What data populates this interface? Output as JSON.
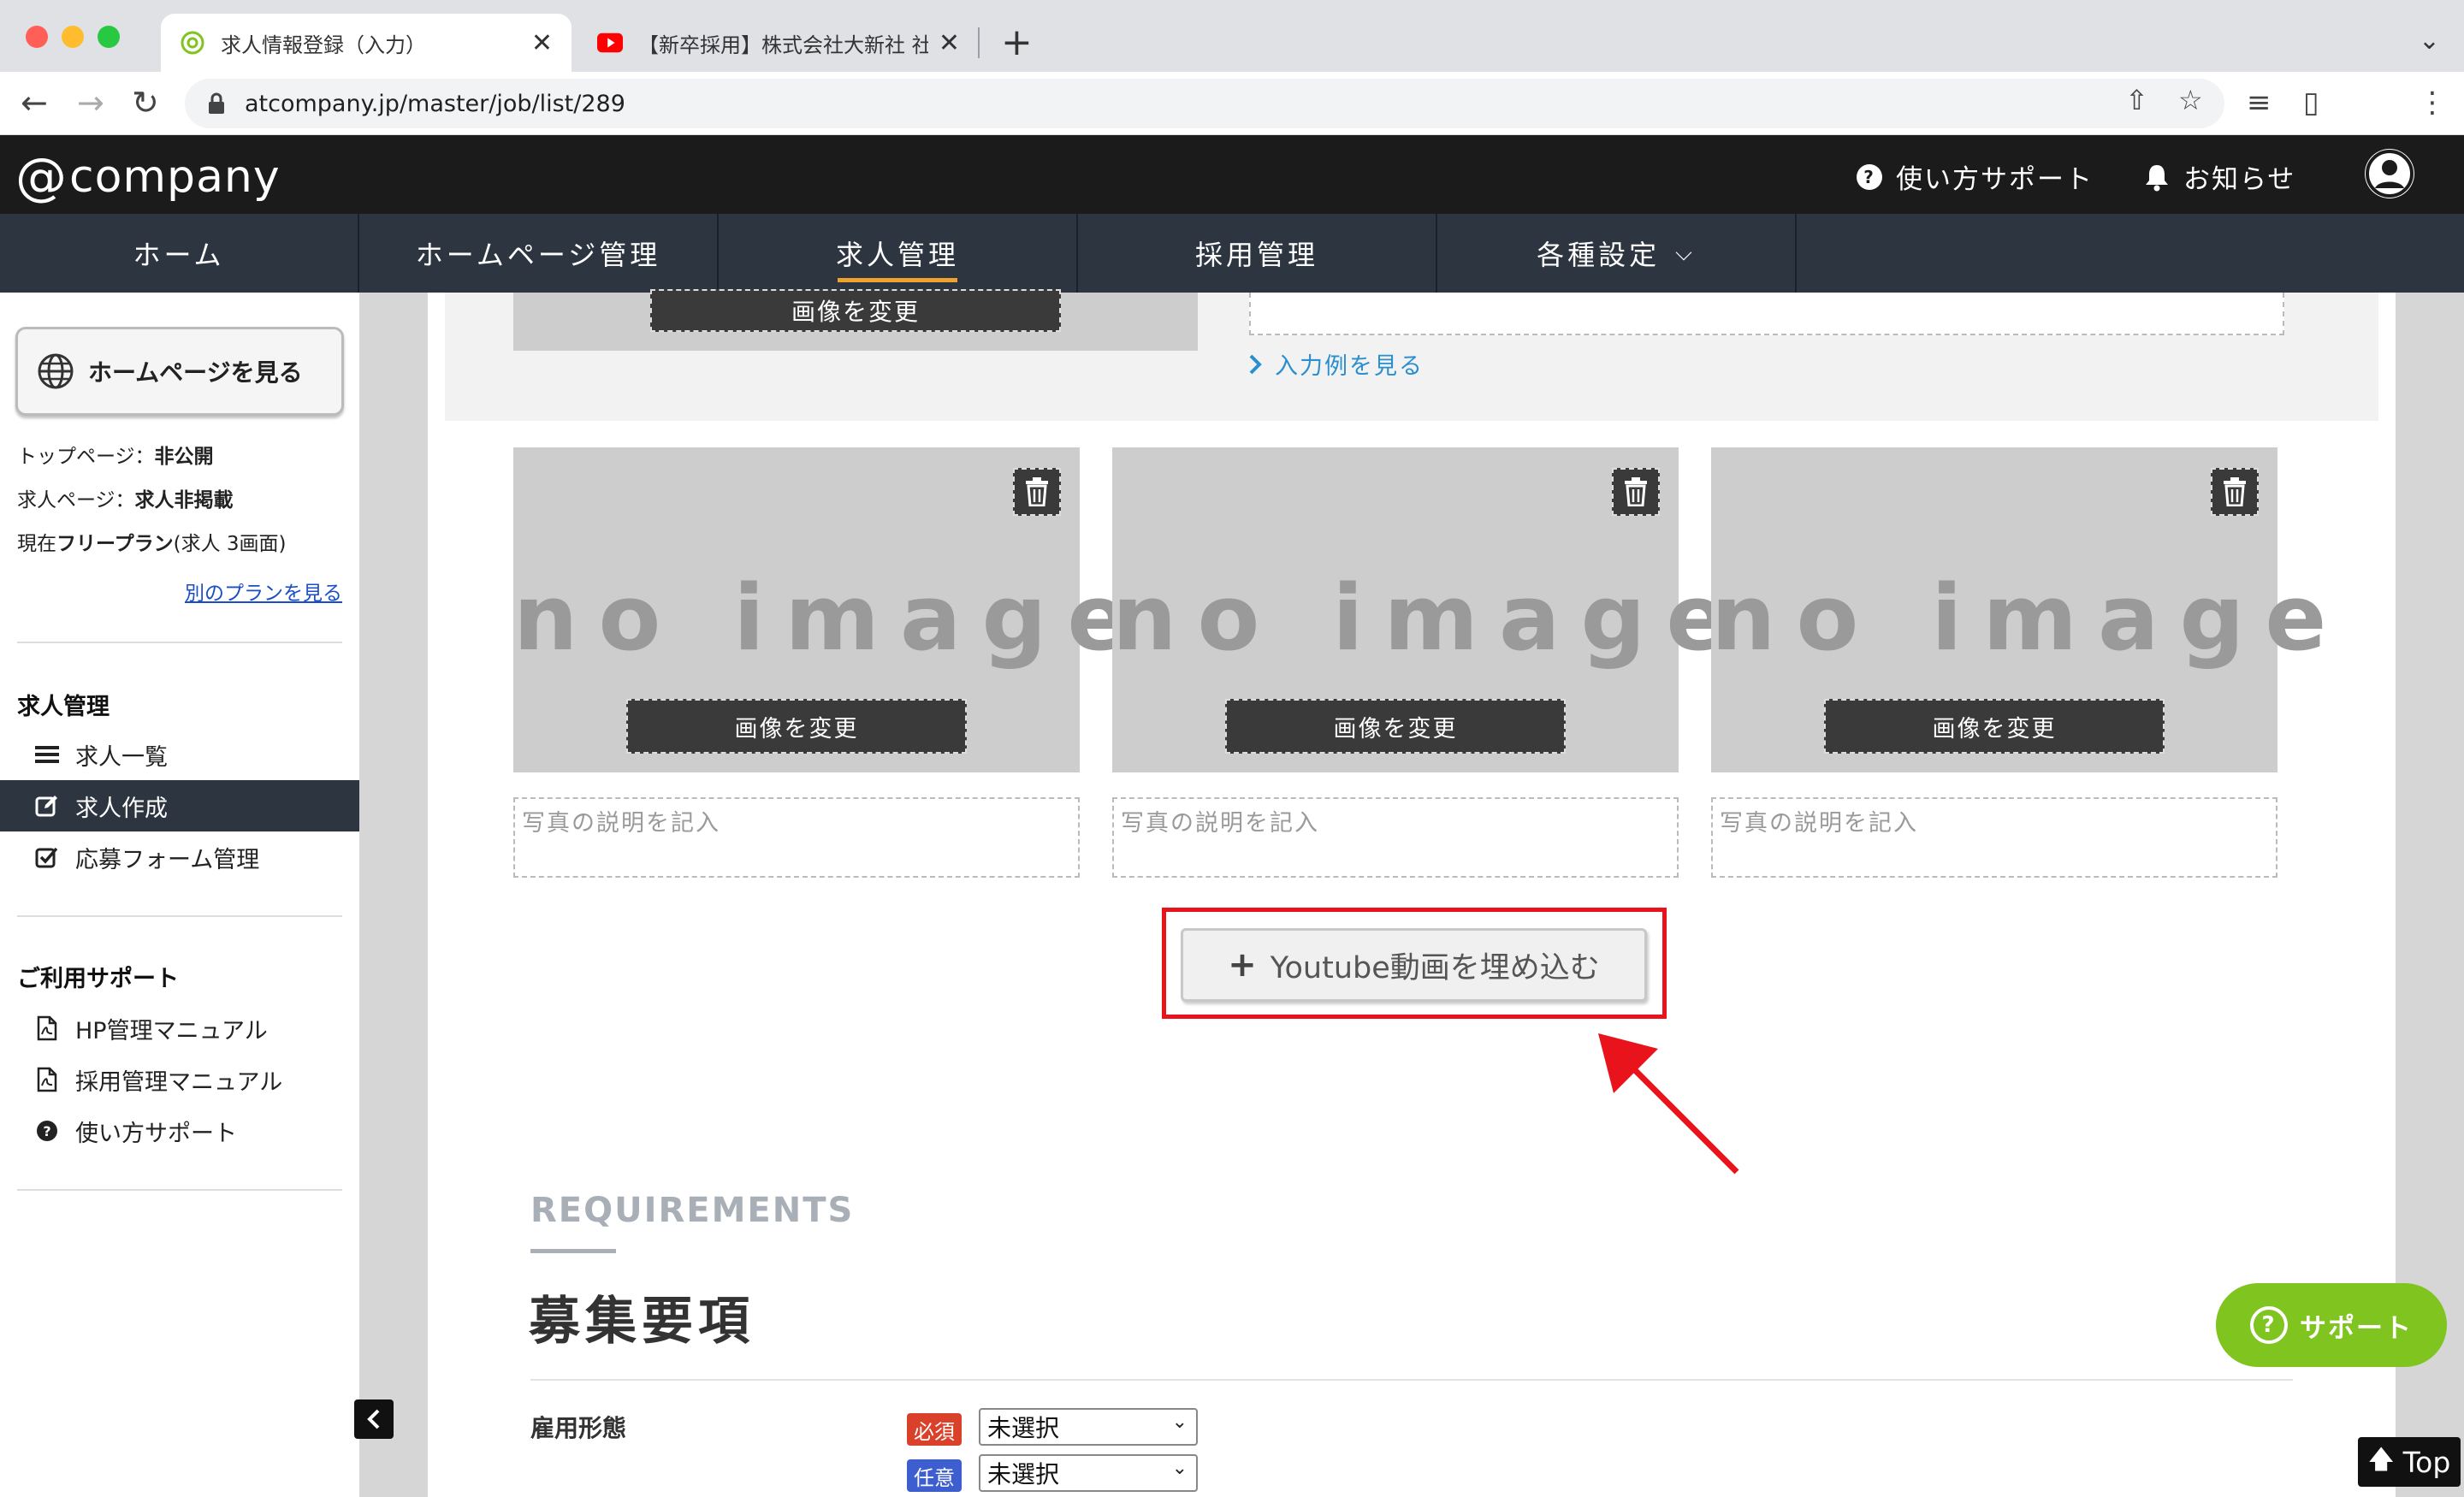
{
  "browser": {
    "tabs": [
      {
        "title": "求人情報登録（入力）",
        "active": true,
        "favicon": "at-icon"
      },
      {
        "title": "【新卒採用】株式会社大新社 社長",
        "active": false,
        "favicon": "youtube-icon"
      }
    ],
    "url": "atcompany.jp/master/job/list/289"
  },
  "header": {
    "logo_at": "@",
    "logo_text": "company",
    "support_label": "使い方サポート",
    "notice_label": "お知らせ"
  },
  "nav": {
    "items": [
      {
        "label": "ホーム"
      },
      {
        "label": "ホームページ管理"
      },
      {
        "label": "求人管理"
      },
      {
        "label": "採用管理"
      },
      {
        "label": "各種設定"
      }
    ]
  },
  "sidebar": {
    "hp_button": "ホームページを見る",
    "top_page_key": "トップページ：",
    "top_page_val": "非公開",
    "job_page_key": "求人ページ：",
    "job_page_val": "求人非掲載",
    "plan_pre": "現在",
    "plan_name": "フリープラン",
    "plan_post": "(求人 3画面)",
    "plan_link": "別のプランを見る",
    "section1_title": "求人管理",
    "section1_items": [
      {
        "label": "求人一覧"
      },
      {
        "label": "求人作成"
      },
      {
        "label": "応募フォーム管理"
      }
    ],
    "section2_title": "ご利用サポート",
    "section2_items": [
      {
        "label": "HP管理マニュアル"
      },
      {
        "label": "採用管理マニュアル"
      },
      {
        "label": "使い方サポート"
      }
    ]
  },
  "content": {
    "top_change_button": "画像を変更",
    "example_link": "入力例を見る",
    "images": [
      {
        "placeholder": "no image",
        "change_label": "画像を変更",
        "desc_placeholder": "写真の説明を記入"
      },
      {
        "placeholder": "no image",
        "change_label": "画像を変更",
        "desc_placeholder": "写真の説明を記入"
      },
      {
        "placeholder": "no image",
        "change_label": "画像を変更",
        "desc_placeholder": "写真の説明を記入"
      }
    ],
    "youtube_button": "Youtube動画を埋め込む",
    "requirements_en": "REQUIREMENTS",
    "requirements_ja": "募集要項",
    "employment_label": "雇用形態",
    "required_badge": "必須",
    "optional_badge": "任意",
    "select_value_1": "未選択",
    "select_value_2": "未選択"
  },
  "floating": {
    "support_label": "サポート",
    "top_label": "Top"
  },
  "colors": {
    "nav_bg": "#2d3640",
    "header_bg": "#1b1b1b",
    "accent_orange": "#f0a22e",
    "highlight_red": "#e8131b",
    "support_green": "#7fc41f",
    "required_red": "#d9412b",
    "optional_blue": "#3d5ecf"
  }
}
